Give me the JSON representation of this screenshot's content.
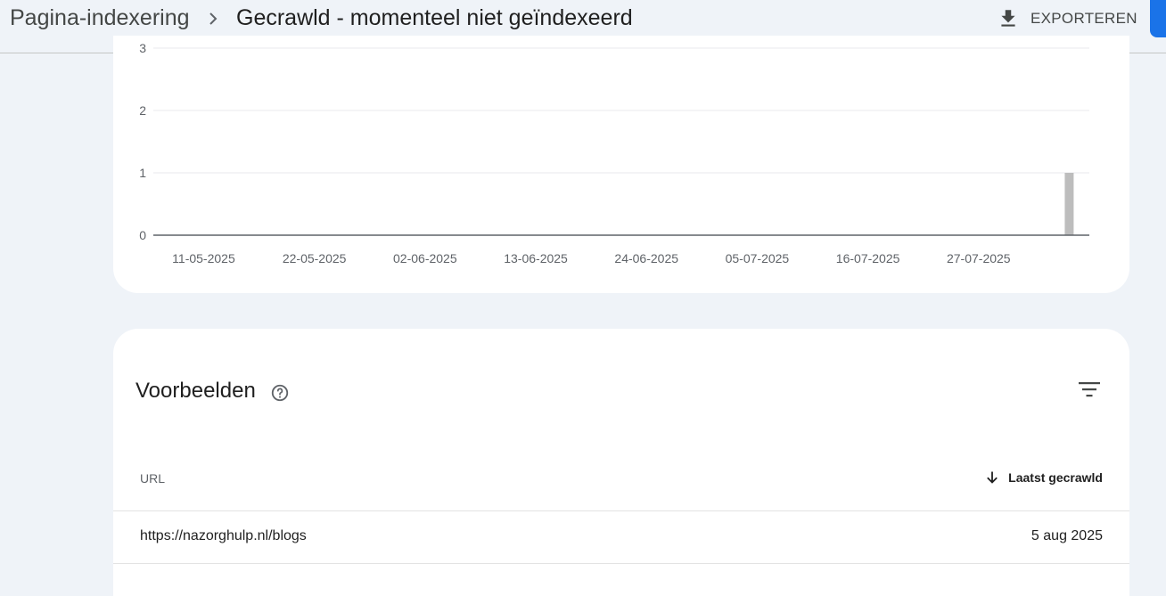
{
  "header": {
    "breadcrumb_parent": "Pagina-indexering",
    "page_title": "Gecrawld - momenteel niet geïndexeerd",
    "export_label": "EXPORTEREN"
  },
  "chart_data": {
    "type": "bar",
    "x": [
      "2025-08-05"
    ],
    "values": [
      1
    ],
    "xlim": [
      "2025-05-06",
      "2025-08-07"
    ],
    "ylim": [
      0,
      3
    ],
    "y_ticks": [
      "3",
      "2",
      "1",
      "0"
    ],
    "x_tick_labels": [
      "11-05-2025",
      "22-05-2025",
      "02-06-2025",
      "13-06-2025",
      "24-06-2025",
      "05-07-2025",
      "16-07-2025",
      "27-07-2025"
    ],
    "grid": true,
    "bar_color": "#bdbdbd",
    "xlabel": "",
    "ylabel": ""
  },
  "examples": {
    "title": "Voorbeelden",
    "columns": {
      "url": "URL",
      "last_crawled": "Laatst gecrawld"
    },
    "rows": [
      {
        "url": "https://nazorghulp.nl/blogs",
        "last_crawled": "5 aug 2025"
      }
    ]
  },
  "icons": {
    "breadcrumb_separator": "chevron-right-icon",
    "export": "download-icon",
    "help": "help-circle-icon",
    "filter": "filter-icon",
    "sort": "arrow-down-icon"
  }
}
